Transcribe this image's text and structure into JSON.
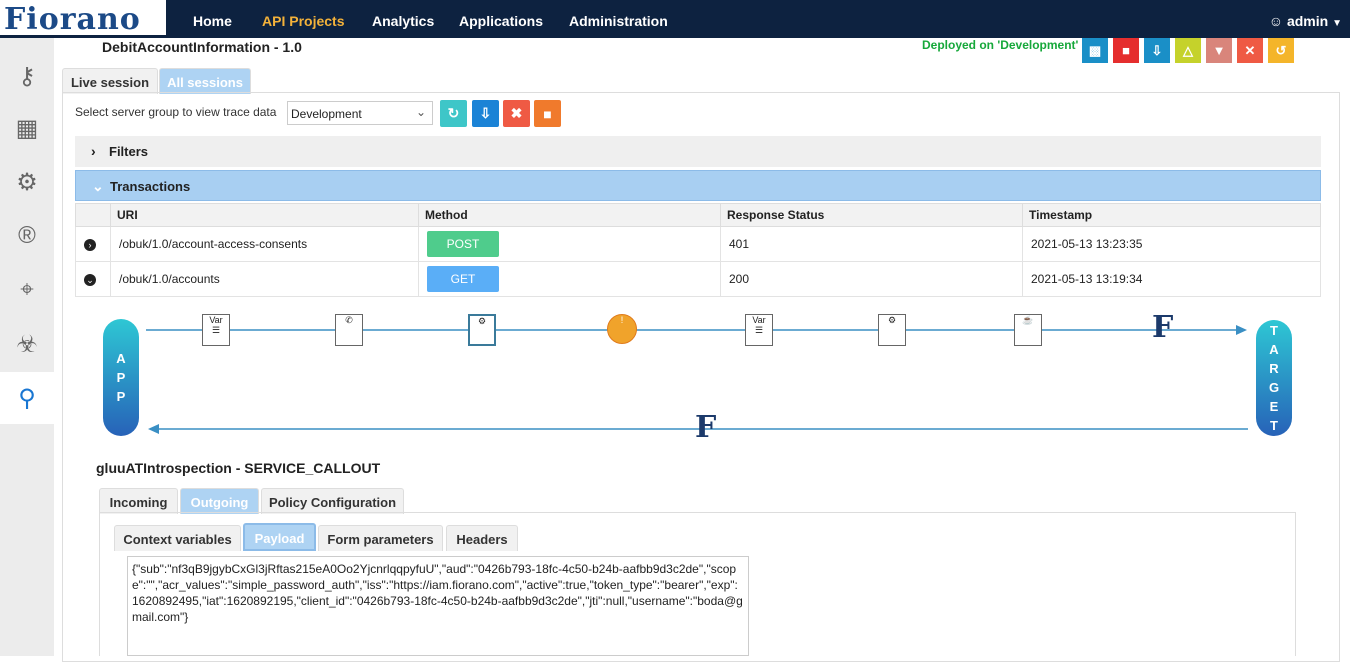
{
  "app": {
    "logo": "Fiorano"
  },
  "nav": {
    "items": [
      "Home",
      "API Projects",
      "Analytics",
      "Applications",
      "Administration"
    ],
    "active": "API Projects",
    "user": "admin"
  },
  "sidebar": {
    "icons": [
      "key-icon",
      "flow-icon",
      "gear-icon",
      "registered-icon",
      "crosshair-icon",
      "bug-icon",
      "search-icon"
    ],
    "active": "search-icon"
  },
  "header": {
    "title": "DebitAccountInformation - 1.0",
    "deployed": "Deployed on 'Development'",
    "toolbar": [
      {
        "icon": "save-icon",
        "color": "#1a8fc7"
      },
      {
        "icon": "delete-icon",
        "color": "#e52e2e"
      },
      {
        "icon": "download-icon",
        "color": "#1a8fc7"
      },
      {
        "icon": "sitemap-icon",
        "color": "#c5d22b"
      },
      {
        "icon": "hierarchy-icon",
        "color": "#d9857b"
      },
      {
        "icon": "close-icon",
        "color": "#ef5a44"
      },
      {
        "icon": "undo-icon",
        "color": "#f4b52a"
      }
    ]
  },
  "session_tabs": [
    "Live session",
    "All sessions"
  ],
  "server": {
    "label": "Select server group to view trace data",
    "value": "Development"
  },
  "filters": {
    "label": "Filters"
  },
  "transactions": {
    "label": "Transactions",
    "columns": [
      "URI",
      "Method",
      "Response Status",
      "Timestamp"
    ],
    "rows": [
      {
        "uri": "/obuk/1.0/account-access-consents",
        "method": "POST",
        "method_color": "#4fcc8c",
        "status": "401",
        "timestamp": "2021-05-13 13:23:35"
      },
      {
        "uri": "/obuk/1.0/accounts",
        "method": "GET",
        "method_color": "#5aaef7",
        "status": "200",
        "timestamp": "2021-05-13 13:19:34"
      }
    ]
  },
  "flow": {
    "app_label": "APP",
    "target_label": "TARGET",
    "forward_icons": [
      "variable-doc-icon",
      "service-callout-icon",
      "policy-gear-icon",
      "alert-hands-icon",
      "variable-doc-icon",
      "policy-gear-icon",
      "java-doc-icon",
      "fiorano-f-icon"
    ],
    "return_icons": [
      "fiorano-f-icon"
    ]
  },
  "service": {
    "title": "gluuATIntrospection - SERVICE_CALLOUT"
  },
  "detail_tabs": [
    "Incoming",
    "Outgoing",
    "Policy Configuration"
  ],
  "sub_tabs": [
    "Context variables",
    "Payload",
    "Form parameters",
    "Headers"
  ],
  "payload": "{\"sub\":\"nf3qB9jgybCxGl3jRftas215eA0Oo2YjcnrlqqpyfuU\",\"aud\":\"0426b793-18fc-4c50-b24b-aafbb9d3c2de\",\"scope\":\"\",\"acr_values\":\"simple_password_auth\",\"iss\":\"https://iam.fiorano.com\",\"active\":true,\"token_type\":\"bearer\",\"exp\":1620892495,\"iat\":1620892195,\"client_id\":\"0426b793-18fc-4c50-b24b-aafbb9d3c2de\",\"jti\":null,\"username\":\"boda@gmail.com\"}"
}
